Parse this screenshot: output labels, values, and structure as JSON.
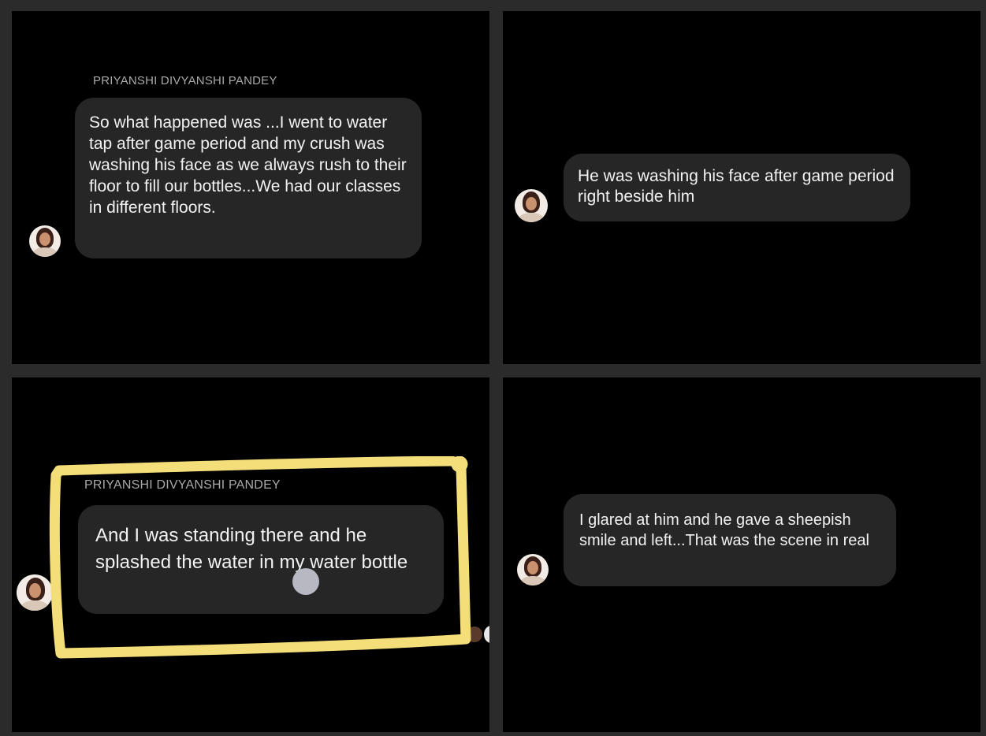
{
  "panels": [
    {
      "sender": "PRIYANSHI DIVYANSHI  PANDEY",
      "message": "So what happened was ...I went to water tap after game period and my crush was washing his face as we always rush to their floor to fill our bottles...We had our classes in different floors."
    },
    {
      "message": "He was washing his face after game period right beside him"
    },
    {
      "sender": "PRIYANSHI DIVYANSHI  PANDEY",
      "message": "And I was standing there and he splashed the water in my water bottle"
    },
    {
      "message": "I glared at him and he gave a sheepish smile and left...That was the scene in real"
    }
  ],
  "colors": {
    "background": "#000000",
    "gutter": "#2b2b2b",
    "bubble": "#262626",
    "text": "#f2f2f2",
    "sender": "#a9a9a9",
    "highlight": "#f4de7a"
  },
  "icons": {
    "avatar": "profile-photo-avatar",
    "touch": "touch-indicator-dot"
  }
}
